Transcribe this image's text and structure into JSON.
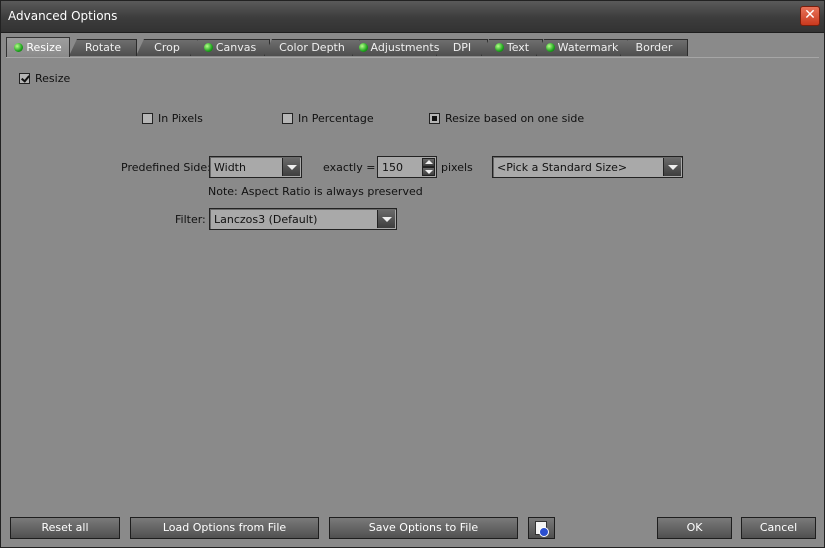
{
  "window": {
    "title": "Advanced Options",
    "close_symbol": "✕"
  },
  "tabs": [
    {
      "label": "Resize",
      "led": true,
      "active": true
    },
    {
      "label": "Rotate",
      "led": false
    },
    {
      "label": "Crop",
      "led": false
    },
    {
      "label": "Canvas",
      "led": true
    },
    {
      "label": "Color Depth",
      "led": false
    },
    {
      "label": "Adjustments",
      "led": true
    },
    {
      "label": "DPI",
      "led": false
    },
    {
      "label": "Text",
      "led": true
    },
    {
      "label": "Watermark",
      "led": true
    },
    {
      "label": "Border",
      "led": false
    }
  ],
  "resize": {
    "enable_label": "Resize",
    "enabled": true,
    "modes": [
      {
        "label": "In Pixels",
        "selected": false
      },
      {
        "label": "In Percentage",
        "selected": false
      },
      {
        "label": "Resize based on one side",
        "selected": true
      }
    ],
    "predefined_side_label": "Predefined Side:",
    "predefined_side_value": "Width",
    "exactly_label": "exactly =",
    "exactly_value": "150",
    "pixels_label": "pixels",
    "standard_size_value": "<Pick a Standard Size>",
    "note": "Note: Aspect Ratio is always preserved",
    "filter_label": "Filter:",
    "filter_value": "Lanczos3 (Default)"
  },
  "footer": {
    "reset_all": "Reset all",
    "load_options": "Load Options from File",
    "save_options": "Save Options to File",
    "ok": "OK",
    "cancel": "Cancel"
  },
  "colors": {
    "panel_bg": "#8a8a8a",
    "titlebar_bg": "#3c3c3c",
    "close_red": "#c8391e",
    "led_green": "#1da31d"
  }
}
